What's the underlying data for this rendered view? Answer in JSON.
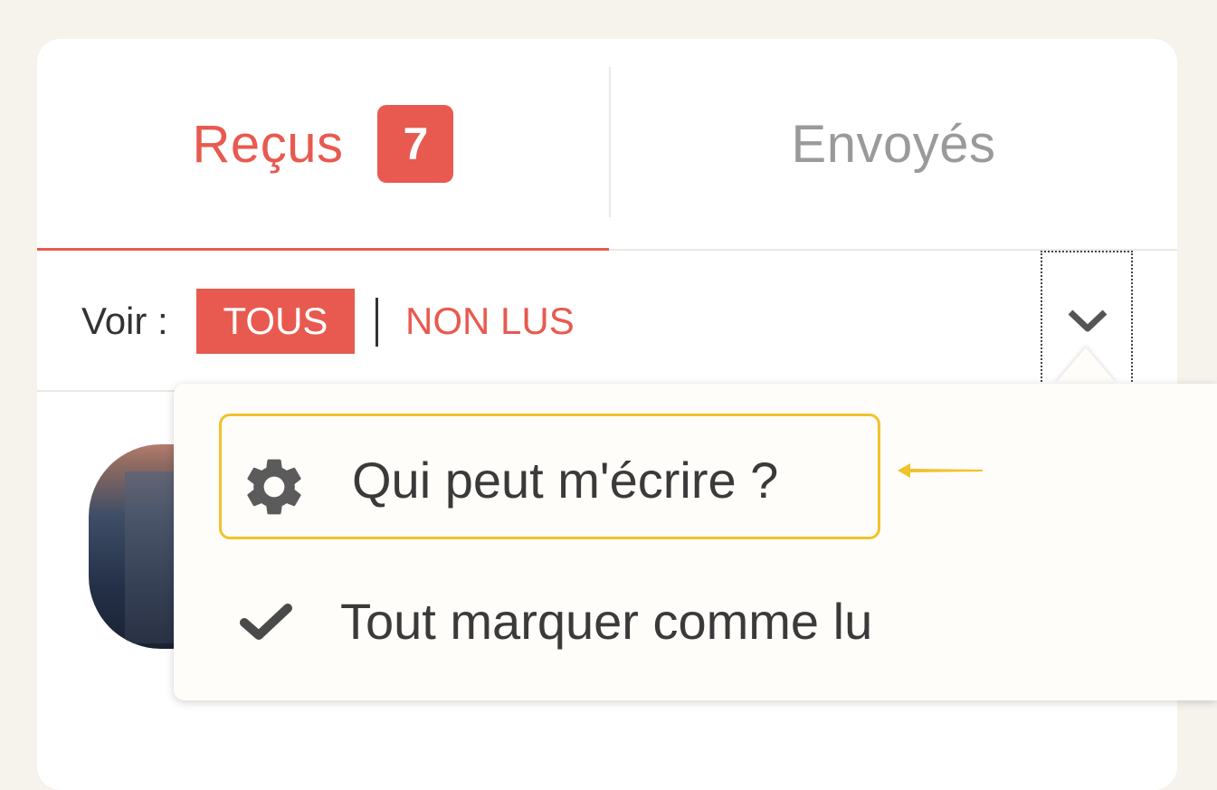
{
  "tabs": {
    "received_label": "Reçus",
    "received_count": "7",
    "sent_label": "Envoyés"
  },
  "filter": {
    "label": "Voir :",
    "all": "TOUS",
    "unread": "NON LUS"
  },
  "dropdown": {
    "items": [
      {
        "label": "Qui peut m'écrire ?",
        "icon": "gear-icon"
      },
      {
        "label": "Tout marquer comme lu",
        "icon": "checkmark-icon"
      }
    ]
  },
  "colors": {
    "accent": "#e85a4f",
    "highlight": "#f2c22a",
    "background": "#f6f2ec"
  }
}
